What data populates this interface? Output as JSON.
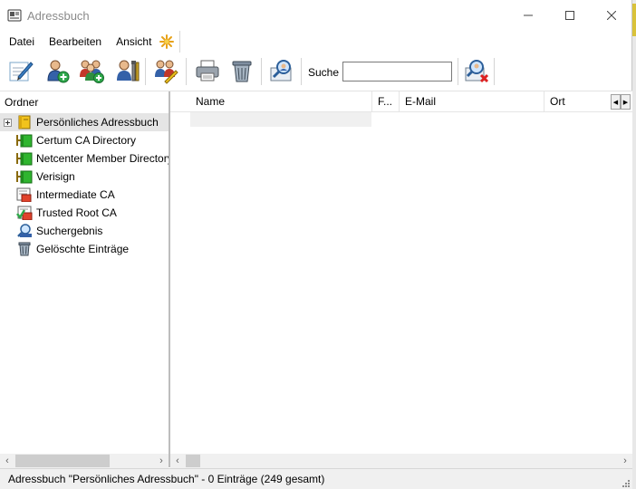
{
  "window": {
    "title": "Adressbuch"
  },
  "menu": [
    "Datei",
    "Bearbeiten",
    "Ansicht"
  ],
  "toolbar": {
    "buttons": [
      {
        "icon": "edit-pen-icon"
      },
      {
        "icon": "new-contact-icon"
      },
      {
        "icon": "new-group-icon"
      },
      {
        "icon": "properties-icon"
      },
      {
        "icon": "group-edit-icon"
      },
      {
        "icon": "print-icon"
      },
      {
        "icon": "delete-icon"
      },
      {
        "icon": "find-people-icon"
      },
      {
        "icon": "search-clear-icon"
      }
    ],
    "search_label": "Suche",
    "search_value": ""
  },
  "left_pane": {
    "header": "Ordner",
    "tree": [
      {
        "label": "Persönliches Adressbuch",
        "icon": "address-book-icon",
        "selected": true,
        "expandable": true
      },
      {
        "label": "Certum CA Directory",
        "icon": "directory-icon"
      },
      {
        "label": "Netcenter Member Directory",
        "icon": "directory-icon"
      },
      {
        "label": "Verisign",
        "icon": "directory-icon"
      },
      {
        "label": "Intermediate CA",
        "icon": "certificate-icon"
      },
      {
        "label": "Trusted Root CA",
        "icon": "trusted-certificate-icon"
      },
      {
        "label": "Suchergebnis",
        "icon": "search-result-icon"
      },
      {
        "label": "Gelöschte Einträge",
        "icon": "trash-icon"
      }
    ]
  },
  "list": {
    "columns": [
      "Name",
      "F...",
      "E-Mail",
      "Ort"
    ]
  },
  "status": {
    "text": "Adressbuch \"Persönliches Adressbuch\" - 0 Einträge (249 gesamt)"
  },
  "colors": {
    "selection": "#e5e5e5",
    "status_bg": "#f0f0f0",
    "directory_green": "#2fb52f",
    "book_yellow": "#f2c31c"
  }
}
